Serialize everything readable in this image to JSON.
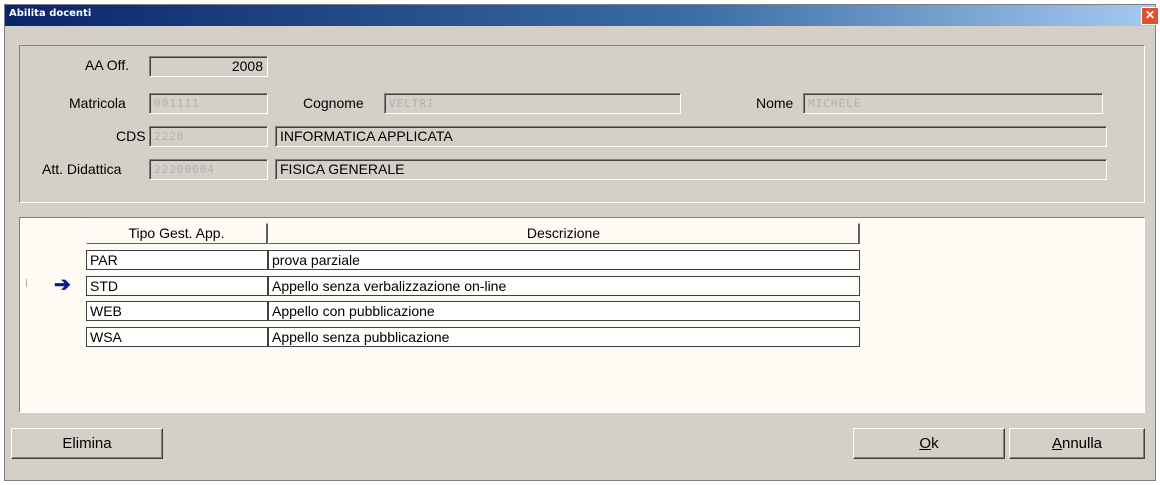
{
  "window": {
    "title": "Abilita docenti",
    "close_glyph": "✕"
  },
  "form": {
    "aa_off_label": "AA Off.",
    "aa_off_value": "2008",
    "matricola_label": "Matricola",
    "matricola_value": "001111",
    "cognome_label": "Cognome",
    "cognome_value": "VELTRI",
    "nome_label": "Nome",
    "nome_value": "MICHELE",
    "cds_label": "CDS",
    "cds_code": "2220",
    "cds_desc": "INFORMATICA APPLICATA",
    "att_label": "Att. Didattica",
    "att_code": "22200004",
    "att_desc": "FISICA GENERALE"
  },
  "grid": {
    "columns": [
      "Tipo Gest. App.",
      "Descrizione"
    ],
    "current_row_glyph": "➔",
    "rows": [
      {
        "tipo": "PAR",
        "descrizione": "prova parziale"
      },
      {
        "tipo": "STD",
        "descrizione": "Appello senza verbalizzazione on-line"
      },
      {
        "tipo": "WEB",
        "descrizione": "Appello con pubblicazione"
      },
      {
        "tipo": "WSA",
        "descrizione": "Appello senza pubblicazione"
      }
    ]
  },
  "buttons": {
    "elimina": "Elimina",
    "ok_mnemonic": "O",
    "ok_rest": "k",
    "annulla_mnemonic": "A",
    "annulla_rest": "nnulla"
  },
  "colors": {
    "title_bar": "#0a246a",
    "dialog_bg": "#d4d0c8",
    "grid_bg": "#fdfbf4",
    "arrow": "#0a1a8a"
  }
}
